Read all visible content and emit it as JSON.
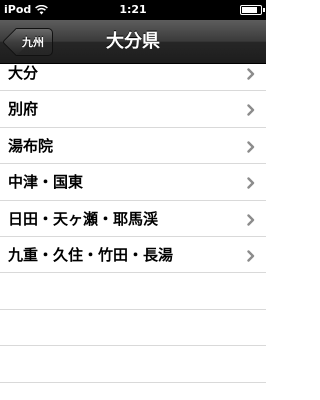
{
  "status_bar": {
    "carrier": "iPod",
    "time": "1:21",
    "battery_level": 0.85
  },
  "nav": {
    "back_label": "九州",
    "title": "大分県"
  },
  "list": {
    "items": [
      {
        "label": "大分"
      },
      {
        "label": "別府"
      },
      {
        "label": "湯布院"
      },
      {
        "label": "中津・国東"
      },
      {
        "label": "日田・天ヶ瀬・耶馬渓"
      },
      {
        "label": "九重・久住・竹田・長湯"
      },
      {
        "label": ""
      },
      {
        "label": ""
      },
      {
        "label": ""
      }
    ]
  },
  "icons": {
    "row_disclosure": "chevron-right-icon",
    "wifi": "wifi-icon",
    "battery": "battery-icon"
  },
  "colors": {
    "status_bar_bg": "#000000",
    "nav_bar_bg": "#2b2b2b",
    "separator": "#d9d9d9",
    "chevron": "#8c8c8c"
  }
}
